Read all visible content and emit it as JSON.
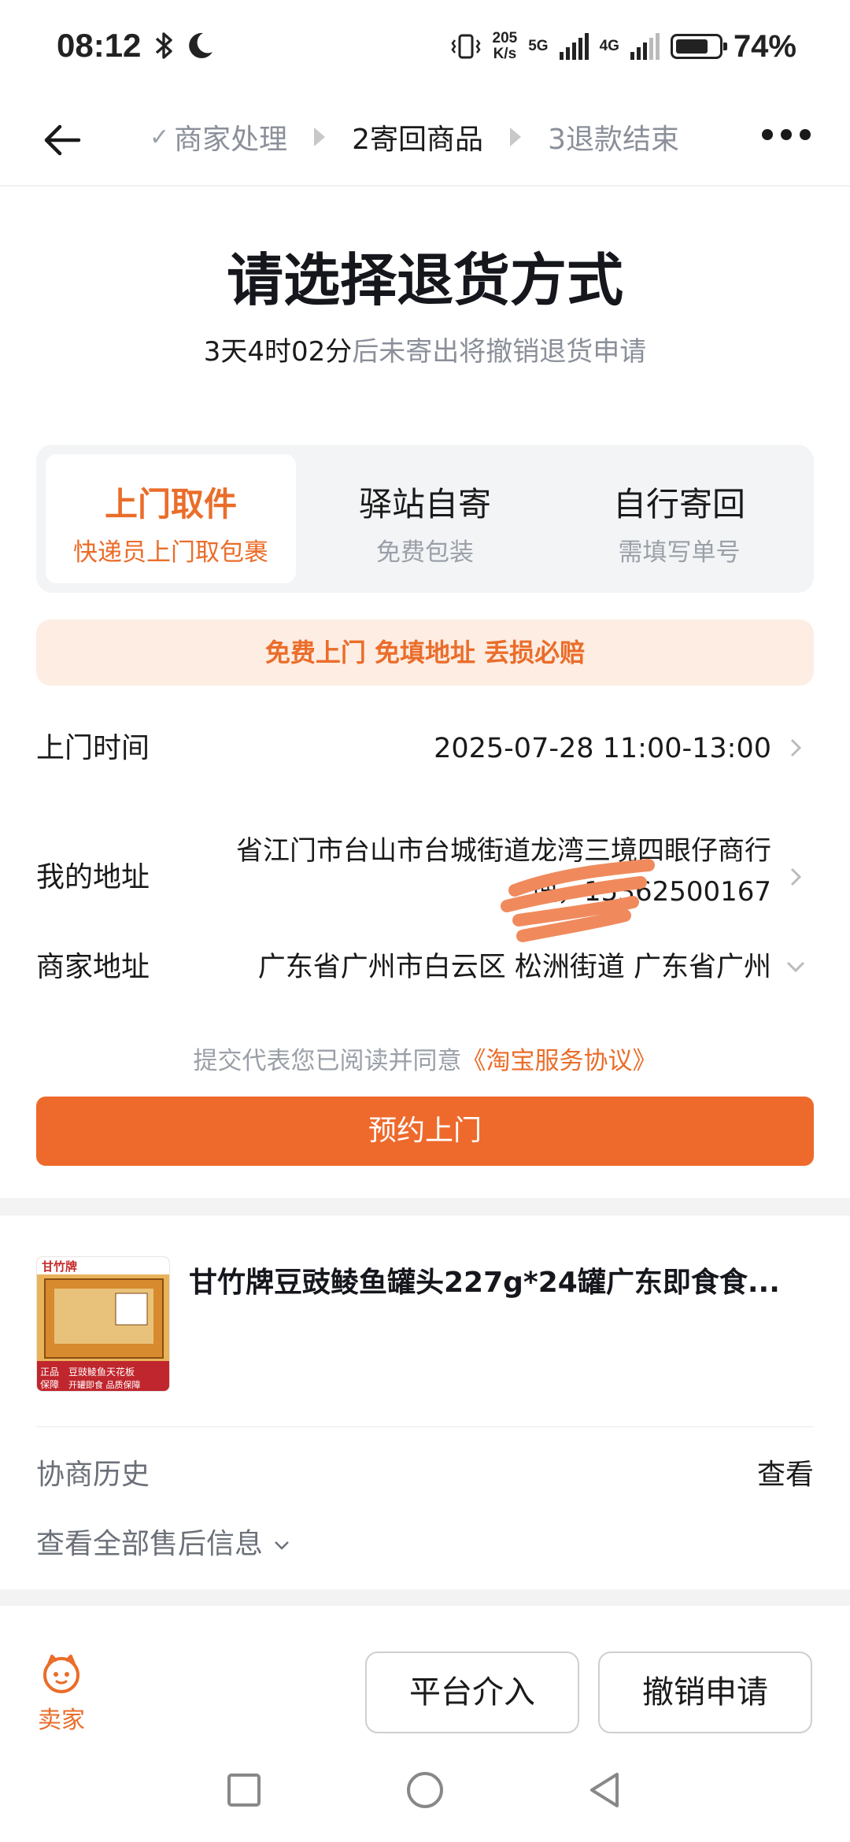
{
  "status_bar": {
    "time": "08:12",
    "speed_value": "205",
    "speed_unit": "K/s",
    "net_5g": "5G",
    "net_4g": "4G",
    "battery": "74%",
    "icons": [
      "bluetooth-icon",
      "moon-icon",
      "vibrate-icon",
      "signal-icon",
      "battery-icon"
    ]
  },
  "nav": {
    "steps": [
      {
        "label": "商家处理",
        "state": "done"
      },
      {
        "label": "2寄回商品",
        "state": "active"
      },
      {
        "label": "3退款结束",
        "state": "pending"
      }
    ]
  },
  "main": {
    "title": "请选择退货方式",
    "countdown": "3天4时02分",
    "countdown_suffix": "后未寄出将撤销退货申请",
    "tabs": [
      {
        "title": "上门取件",
        "sub": "快递员上门取包裹",
        "active": true
      },
      {
        "title": "驿站自寄",
        "sub": "免费包装",
        "active": false
      },
      {
        "title": "自行寄回",
        "sub": "需填写单号",
        "active": false
      }
    ],
    "promo": "免费上门 免填地址 丢损必赔",
    "pickup_time_label": "上门时间",
    "pickup_time_value": "2025-07-28 11:00-13:00",
    "my_address_label": "我的地址",
    "my_address_line1": "省江门市台山市台城街道龙湾三境四眼仔商行",
    "my_address_line2": "理，15362500167",
    "merchant_address_label": "商家地址",
    "merchant_address_value": "广东省广州市白云区 松洲街道 广东省广州",
    "agree_prefix": "提交代表您已阅读并同意",
    "agree_link": "《淘宝服务协议》",
    "submit_button": "预约上门"
  },
  "product": {
    "image_brand": "甘竹牌",
    "image_badge1": "正品保障",
    "image_badge2": "豆豉鲮鱼天花板",
    "image_badge3": "开罐即食 品质保障",
    "name": "甘竹牌豆豉鲮鱼罐头227g*24罐广东即食食...",
    "history_label": "协商历史",
    "history_view": "查看",
    "more_info": "查看全部售后信息"
  },
  "bottom": {
    "seller_label": "卖家",
    "platform_button": "平台介入",
    "cancel_button": "撤销申请"
  },
  "colors": {
    "accent": "#ee6a2c",
    "promo_bg": "#fdede3",
    "text_primary": "#1a1a1a",
    "text_secondary": "#8a8f99"
  }
}
